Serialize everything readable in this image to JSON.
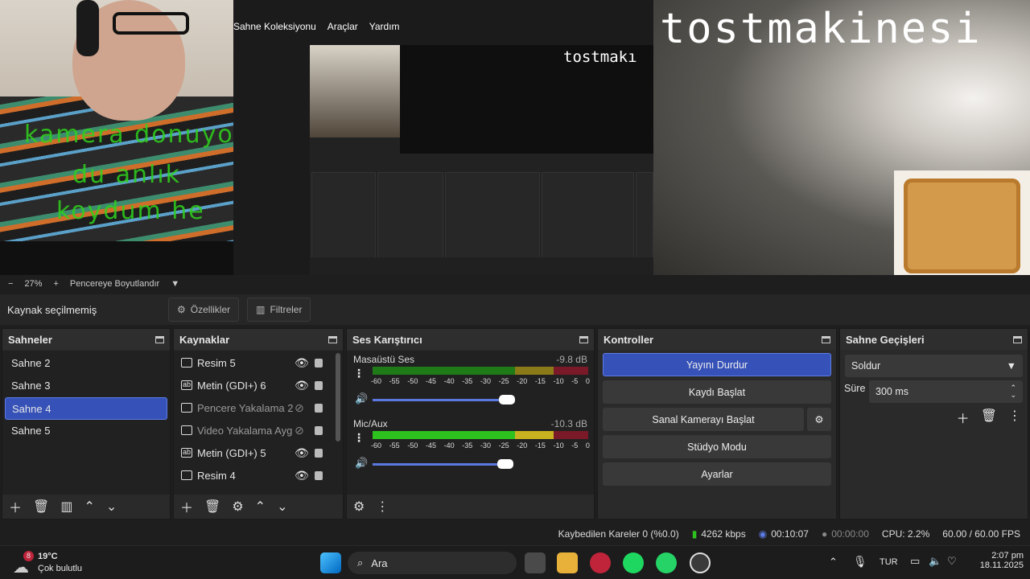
{
  "preview": {
    "overlay_text_left": [
      "kamera donuyo",
      "du anlık",
      "koydum he"
    ],
    "overlay_text_right": "tostmakinesi",
    "nested_overlay_text": "tostmakı",
    "mini_menu": [
      "Sahne Koleksiyonu",
      "Araçlar",
      "Yardım"
    ]
  },
  "zoom": {
    "minus": "−",
    "value": "27%",
    "plus": "+",
    "fit_label": "Pencereye Boyutlandır"
  },
  "props": {
    "status": "Kaynak seçilmemiş",
    "properties": "Özellikler",
    "filters": "Filtreler"
  },
  "scenes": {
    "title": "Sahneler",
    "items": [
      "Sahne 2",
      "Sahne 3",
      "Sahne 4",
      "Sahne 5"
    ],
    "selected": "Sahne 4"
  },
  "sources": {
    "title": "Kaynaklar",
    "items": [
      {
        "label": "Resim 5",
        "icon": "image-icon",
        "visible": true
      },
      {
        "label": "Metin (GDI+) 6",
        "icon": "text-icon",
        "visible": true
      },
      {
        "label": "Pencere Yakalama 2",
        "icon": "window-icon",
        "visible": false
      },
      {
        "label": "Video Yakalama Ayg",
        "icon": "camera-icon",
        "visible": false
      },
      {
        "label": "Metin (GDI+) 5",
        "icon": "text-icon",
        "visible": true
      },
      {
        "label": "Resim 4",
        "icon": "image-icon",
        "visible": true
      }
    ]
  },
  "mixer": {
    "title": "Ses Karıştırıcı",
    "ticks": [
      "-60",
      "-55",
      "-50",
      "-45",
      "-40",
      "-35",
      "-30",
      "-25",
      "-20",
      "-15",
      "-10",
      "-5",
      "0"
    ],
    "channels": [
      {
        "name": "Masaüstü Ses",
        "db": "-9.8 dB",
        "volume": 0.76
      },
      {
        "name": "Mic/Aux",
        "db": "-10.3 dB",
        "volume": 0.75
      }
    ]
  },
  "controls": {
    "title": "Kontroller",
    "stop_stream": "Yayını Durdur",
    "start_record": "Kaydı Başlat",
    "virtual_cam": "Sanal Kamerayı Başlat",
    "studio_mode": "Stüdyo Modu",
    "settings": "Ayarlar"
  },
  "transitions": {
    "title": "Sahne Geçişleri",
    "selected": "Soldur",
    "duration_label": "Süre",
    "duration_value": "300 ms"
  },
  "status": {
    "dropped": "Kaybedilen Kareler 0 (%0.0)",
    "bitrate": "4262 kbps",
    "stream_time": "00:10:07",
    "record_time": "00:00:00",
    "cpu": "CPU: 2.2%",
    "fps": "60.00 / 60.00 FPS"
  },
  "taskbar": {
    "weather_temp": "19°C",
    "weather_desc": "Çok bulutlu",
    "weather_badge": "8",
    "search": "Ara",
    "lang": "TUR",
    "time": "2:07 pm",
    "date": "18.11.2025"
  },
  "colors": {
    "accent": "#3652b8",
    "meter_green": "#2ec21f",
    "meter_yellow": "#c9b21f",
    "meter_red": "#c0243a"
  }
}
